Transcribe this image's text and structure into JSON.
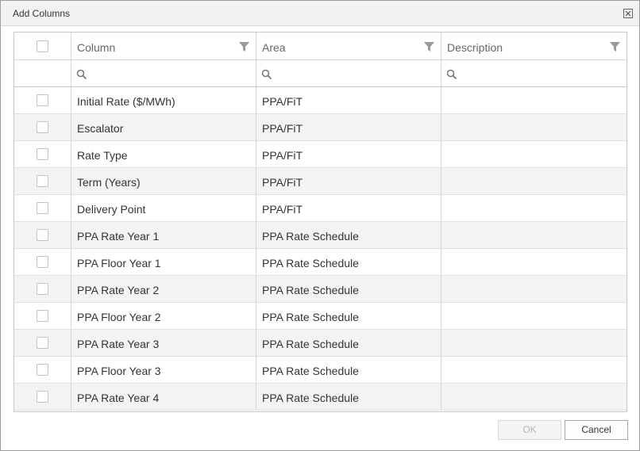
{
  "dialog": {
    "title": "Add Columns",
    "close_icon": "close-icon"
  },
  "grid": {
    "headers": {
      "column": "Column",
      "area": "Area",
      "description": "Description"
    },
    "rows": [
      {
        "column": "Initial Rate ($/MWh)",
        "area": "PPA/FiT",
        "description": ""
      },
      {
        "column": "Escalator",
        "area": "PPA/FiT",
        "description": ""
      },
      {
        "column": "Rate Type",
        "area": "PPA/FiT",
        "description": ""
      },
      {
        "column": "Term (Years)",
        "area": "PPA/FiT",
        "description": ""
      },
      {
        "column": "Delivery Point",
        "area": "PPA/FiT",
        "description": ""
      },
      {
        "column": "PPA Rate Year 1",
        "area": "PPA Rate Schedule",
        "description": ""
      },
      {
        "column": "PPA Floor Year 1",
        "area": "PPA Rate Schedule",
        "description": ""
      },
      {
        "column": "PPA Rate Year 2",
        "area": "PPA Rate Schedule",
        "description": ""
      },
      {
        "column": "PPA Floor Year 2",
        "area": "PPA Rate Schedule",
        "description": ""
      },
      {
        "column": "PPA Rate Year 3",
        "area": "PPA Rate Schedule",
        "description": ""
      },
      {
        "column": "PPA Floor Year 3",
        "area": "PPA Rate Schedule",
        "description": ""
      },
      {
        "column": "PPA Rate Year 4",
        "area": "PPA Rate Schedule",
        "description": ""
      }
    ]
  },
  "footer": {
    "ok_label": "OK",
    "cancel_label": "Cancel"
  }
}
